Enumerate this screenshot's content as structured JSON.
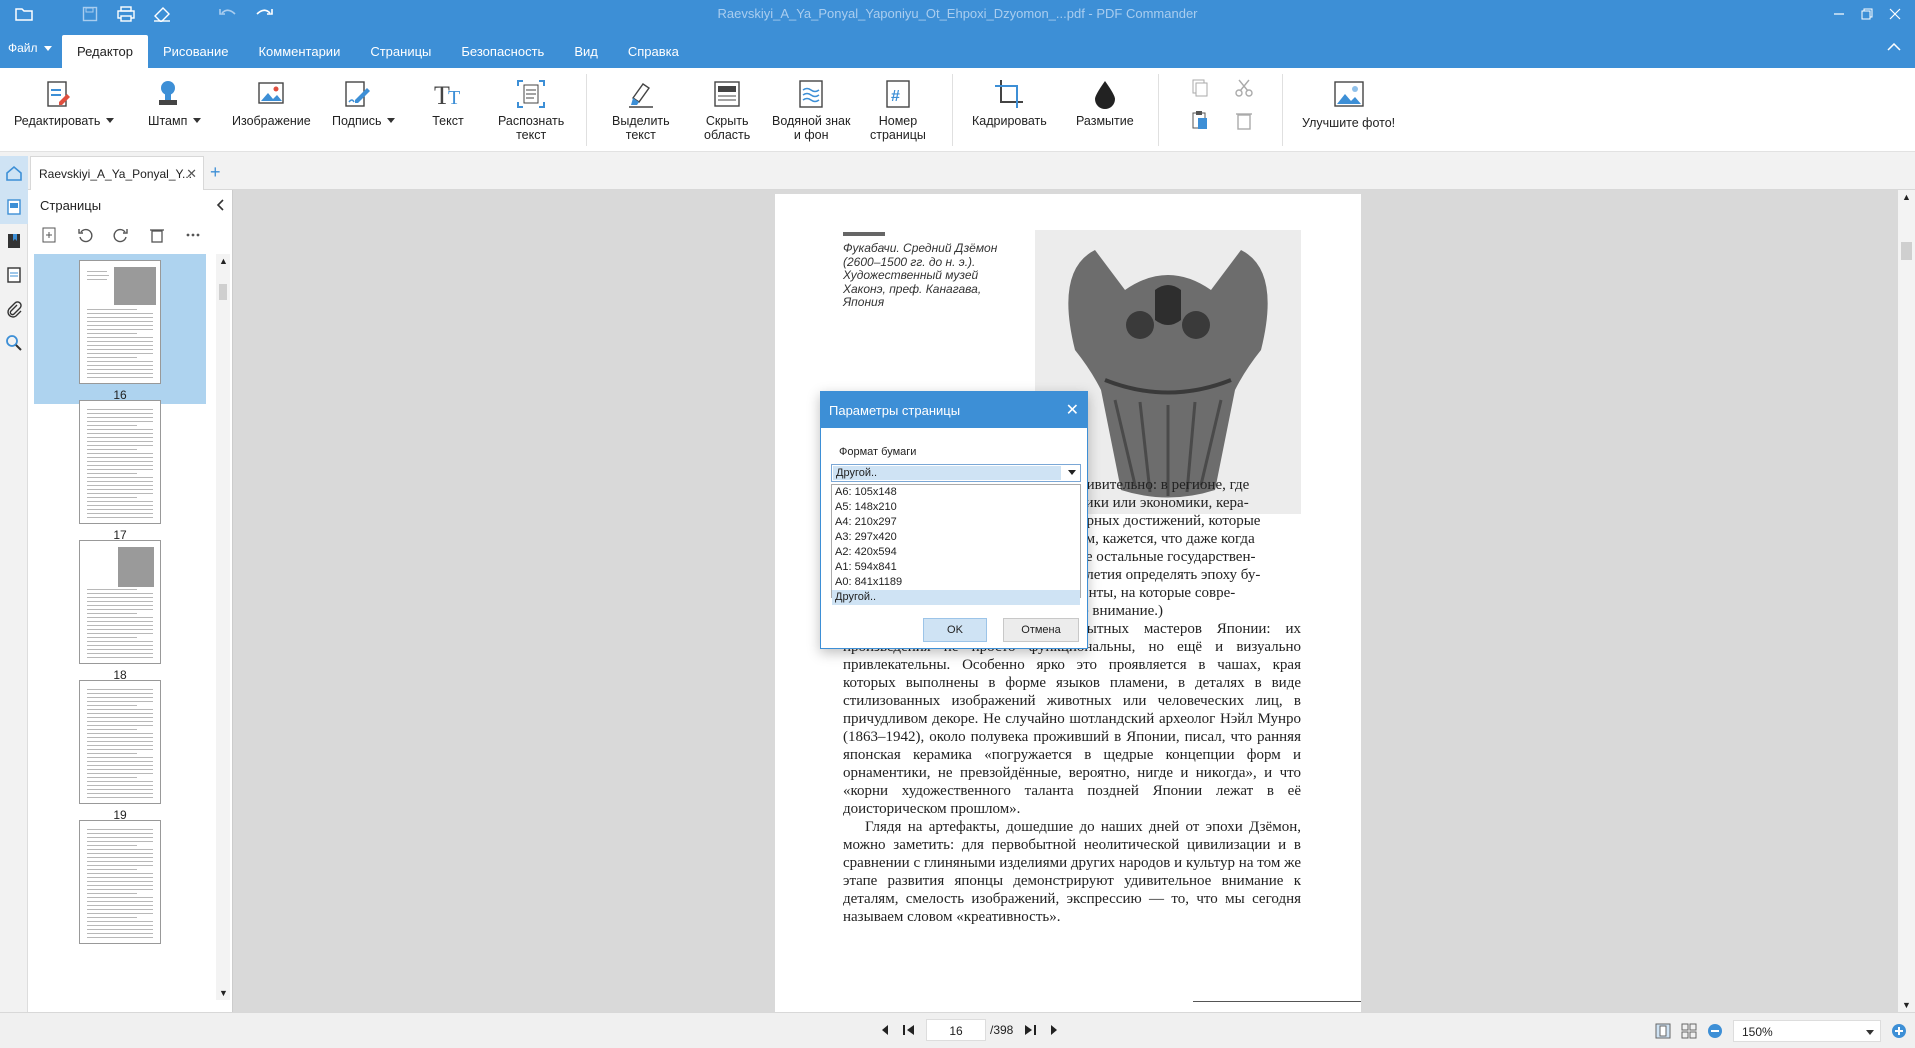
{
  "window": {
    "title": "Raevskiyi_A_Ya_Ponyal_Yaponiyu_Ot_Ehpoxi_Dzyomon_...pdf - PDF Commander"
  },
  "menu": {
    "file_label": "Файл",
    "tabs": [
      "Редактор",
      "Рисование",
      "Комментарии",
      "Страницы",
      "Безопасность",
      "Вид",
      "Справка"
    ],
    "active_tab": "Редактор"
  },
  "ribbon": {
    "edit": "Редактировать",
    "stamp": "Штамп",
    "image": "Изображение",
    "signature": "Подпись",
    "text": "Текст",
    "ocr_line1": "Распознать",
    "ocr_line2": "текст",
    "highlight_line1": "Выделить",
    "highlight_line2": "текст",
    "hide_line1": "Скрыть",
    "hide_line2": "область",
    "watermark_line1": "Водяной знак",
    "watermark_line2": "и фон",
    "pagenum_line1": "Номер",
    "pagenum_line2": "страницы",
    "crop": "Кадрировать",
    "blur": "Размытие",
    "enhance": "Улучшите фото!"
  },
  "document_tab": {
    "name": "Raevskiyi_A_Ya_Ponyal_Y..."
  },
  "pages_panel": {
    "title": "Страницы",
    "thumbnails": [
      {
        "number": "16",
        "selected": true
      },
      {
        "number": "17",
        "selected": false
      },
      {
        "number": "18",
        "selected": false
      },
      {
        "number": "19",
        "selected": false
      }
    ]
  },
  "page_content": {
    "caption": "Фукабачи. Средний Дзёмон (2600–1500 гг. до н. э.). Художественный музей Хаконэ, преф. Канагава, Япония",
    "line1": "дивительно: в регионе, где",
    "line2": "тики или экономики, кера-",
    "line3": "урных достижений, которые",
    "line4": "ем, кажется, что даже когда",
    "line5": "се остальные государствен-",
    "line6": "олетия определять эпоху бу-",
    "line7": "дет керамика или те культурные элементы, на которые совре-",
    "line8": "менники не всегда обращают должное внимание.)",
    "para2": "Надо отметить талант первобытных мастеров Японии: их произведения не просто функциональны, но ещё и визуально привлекательны. Особенно ярко это проявляется в чашах, края которых выполнены в форме языков пламени, в деталях в виде стилизованных изображений животных или человеческих лиц, в причудливом декоре. Не случайно шотландский археолог Нэйл Мунро (1863–1942), около полувека проживший в Японии, писал, что ранняя японская керамика «погружается в щедрые концепции форм и орнаментики, не превзойдённые, вероятно, нигде и никогда», и что «корни художественного таланта поздней Японии лежат в её доисторическом прошлом».",
    "para3": "Глядя на артефакты, дошедшие до наших дней от эпохи Дзёмон, можно заметить: для первобытной неолитической цивилизации и в сравнении с глиняными изделиями других народов и культур на том же этапе развития японцы демонстрируют удивительное внимание к деталям, смелость изображений, экспрессию — то, что мы сегодня называем словом «креативность»."
  },
  "dialog": {
    "title": "Параметры страницы",
    "paper_format_label": "Формат бумаги",
    "selected_value": "Другой..",
    "options": [
      "A6: 105x148",
      "A5: 148x210",
      "A4: 210x297",
      "A3: 297x420",
      "A2: 420x594",
      "A1: 594x841",
      "A0: 841x1189",
      "Другой.."
    ],
    "ok": "OK",
    "cancel": "Отмена"
  },
  "status_bar": {
    "current_page": "16",
    "total_pages": "/398",
    "zoom": "150%"
  },
  "colors": {
    "accent": "#3d8fd6",
    "selection": "#aed3ef"
  }
}
